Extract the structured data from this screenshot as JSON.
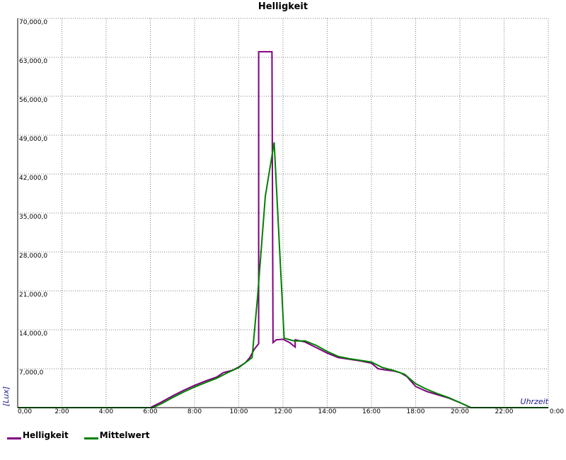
{
  "chart_data": {
    "type": "line",
    "title": "Helligkeit",
    "xlabel": "Uhrzeit",
    "ylabel": "[Lux]",
    "xlim": [
      0,
      24
    ],
    "ylim": [
      0,
      70000
    ],
    "grid": true,
    "legend_position": "bottom-left",
    "x_tick_labels": [
      "0,00",
      "2:00",
      "4:00",
      "6:00",
      "8:00",
      "10:00",
      "12:00",
      "14:00",
      "16:00",
      "18:00",
      "20:00",
      "22:00",
      "0:00"
    ],
    "y_tick_labels": [
      "7,000,0",
      "14,000,0",
      "21,000,0",
      "28,000,0",
      "35,000,0",
      "42,000,0",
      "49,000,0",
      "56,000,0",
      "63,000,0",
      "70,000,0"
    ],
    "y_tick_values": [
      7000,
      14000,
      21000,
      28000,
      35000,
      42000,
      49000,
      56000,
      63000,
      70000
    ],
    "series": [
      {
        "name": "Helligkeit",
        "color": "#800080",
        "points": [
          [
            0,
            0
          ],
          [
            6.0,
            0
          ],
          [
            6.5,
            1000
          ],
          [
            7.0,
            2100
          ],
          [
            7.5,
            3100
          ],
          [
            8.0,
            4000
          ],
          [
            8.5,
            4800
          ],
          [
            9.0,
            5500
          ],
          [
            9.3,
            6300
          ],
          [
            9.7,
            6700
          ],
          [
            10.0,
            7300
          ],
          [
            10.3,
            8100
          ],
          [
            10.5,
            9000
          ],
          [
            10.7,
            10500
          ],
          [
            10.9,
            11500
          ],
          [
            10.9,
            64000
          ],
          [
            11.5,
            64000
          ],
          [
            11.55,
            11700
          ],
          [
            11.7,
            12200
          ],
          [
            12.0,
            12300
          ],
          [
            12.3,
            11700
          ],
          [
            12.55,
            10900
          ],
          [
            12.55,
            12200
          ],
          [
            13.0,
            11800
          ],
          [
            13.5,
            10800
          ],
          [
            14.0,
            9800
          ],
          [
            14.5,
            9000
          ],
          [
            15.0,
            8700
          ],
          [
            15.5,
            8400
          ],
          [
            16.0,
            8000
          ],
          [
            16.3,
            7000
          ],
          [
            16.6,
            6800
          ],
          [
            17.0,
            6600
          ],
          [
            17.3,
            6300
          ],
          [
            17.6,
            5600
          ],
          [
            18.0,
            3800
          ],
          [
            18.5,
            2900
          ],
          [
            19.0,
            2300
          ],
          [
            19.5,
            1700
          ],
          [
            20.0,
            900
          ],
          [
            20.5,
            0
          ],
          [
            24.0,
            0
          ]
        ]
      },
      {
        "name": "Mittelwert",
        "color": "#008000",
        "points": [
          [
            0,
            0
          ],
          [
            6.1,
            0
          ],
          [
            6.5,
            700
          ],
          [
            7.0,
            1800
          ],
          [
            7.5,
            2800
          ],
          [
            8.0,
            3700
          ],
          [
            8.5,
            4500
          ],
          [
            9.0,
            5300
          ],
          [
            9.5,
            6300
          ],
          [
            10.0,
            7200
          ],
          [
            10.3,
            8100
          ],
          [
            10.6,
            9000
          ],
          [
            10.85,
            20000
          ],
          [
            11.2,
            38000
          ],
          [
            11.6,
            47700
          ],
          [
            12.05,
            12500
          ],
          [
            12.5,
            12000
          ],
          [
            13.0,
            12000
          ],
          [
            13.5,
            11200
          ],
          [
            14.0,
            10100
          ],
          [
            14.5,
            9200
          ],
          [
            15.0,
            8800
          ],
          [
            15.5,
            8500
          ],
          [
            16.0,
            8200
          ],
          [
            16.5,
            7200
          ],
          [
            17.0,
            6700
          ],
          [
            17.5,
            6000
          ],
          [
            18.0,
            4300
          ],
          [
            18.5,
            3300
          ],
          [
            19.0,
            2500
          ],
          [
            19.5,
            1800
          ],
          [
            20.0,
            900
          ],
          [
            20.5,
            0
          ],
          [
            24.0,
            0
          ]
        ]
      }
    ]
  }
}
